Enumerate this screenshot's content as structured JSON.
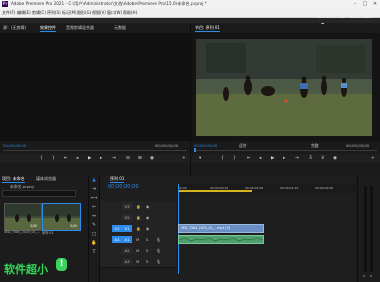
{
  "window": {
    "title": "Adobe Premiere Pro 2021 - C:\\用户\\Administrator\\文档\\Adobe\\Premiere Pro\\15.0\\未命名.prproj *"
  },
  "watermark": "rjcxb.com",
  "menu": [
    "文件(F)",
    "编辑(E)",
    "剪辑(C)",
    "序列(S)",
    "标记(M)",
    "图形(G)",
    "视图(V)",
    "窗口(W)",
    "帮助(H)"
  ],
  "source_monitor": {
    "tabs": [
      "源：(无剪辑)",
      "效果控件",
      "音频剪辑混合器",
      "元数据"
    ],
    "timecode": "00;00;00;00",
    "timecode_right": "00;00;00;00"
  },
  "program_monitor": {
    "tab": "节目: 序列 01",
    "timecode": "00;00;00;00",
    "fit": "适合",
    "quality": "完整",
    "duration": "00;00;03;00"
  },
  "project": {
    "tabs": [
      "项目: 未命名",
      "媒体浏览器"
    ],
    "filename": "未命名.prproj",
    "search_placeholder": "",
    "items": [
      {
        "name": "3ED_7584_2020_01_...",
        "meta": "3;00"
      },
      {
        "name": "序列 01",
        "meta": "3;00"
      }
    ]
  },
  "timeline": {
    "tab": "序列 01",
    "timecode": "00;00;00;00",
    "ruler": [
      "00;00",
      "00;00;00;15",
      "00;00;01;00",
      "00;00;01;15",
      "00;00;02;00"
    ],
    "video_tracks": [
      "V3",
      "V2",
      "V1"
    ],
    "audio_tracks": [
      "A1",
      "A2",
      "A3"
    ],
    "clip_video": "3ED_7584_2020_01_...mp4 [V]",
    "clip_audio": ""
  },
  "brand_overlay": "软件超小",
  "colors": {
    "accent": "#2d8ceb",
    "clip_video": "#6a8fc4",
    "clip_audio": "#4f9f6e"
  }
}
